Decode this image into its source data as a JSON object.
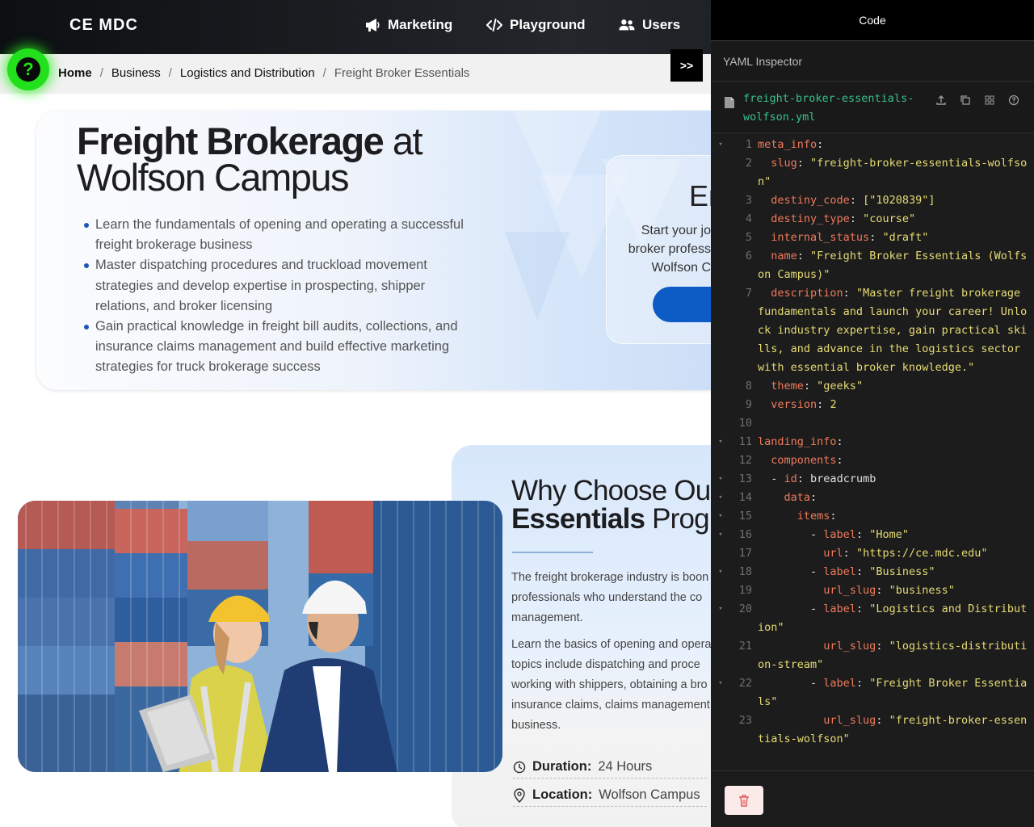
{
  "nav": {
    "brand": "CE MDC",
    "items": [
      {
        "label": "Marketing",
        "icon": "megaphone-icon"
      },
      {
        "label": "Playground",
        "icon": "code-icon"
      },
      {
        "label": "Users",
        "icon": "users-icon"
      }
    ]
  },
  "breadcrumb": {
    "items": [
      "Home",
      "Business",
      "Logistics and Distribution",
      "Freight Broker Essentials"
    ],
    "separator": "/"
  },
  "help_button": {
    "label": "?"
  },
  "toggle_button": {
    "label": ">>"
  },
  "hero": {
    "title_bold": "Freight Brokerage",
    "title_rest_1": " at",
    "title_line2": "Wolfson Campus",
    "bullets": [
      "Learn the fundamentals of opening and operating a successful freight brokerage business",
      "Master dispatching procedures and truckload movement strategies and develop expertise in prospecting, shipper relations, and broker licensing",
      "Gain practical knowledge in freight bill audits, collections, and insurance claims management and build effective marketing strategies for truck brokerage success"
    ]
  },
  "enroll": {
    "title_partial": "Er",
    "lines": [
      "Start your jo",
      "broker profess",
      "Wolfson C"
    ]
  },
  "why": {
    "title_line1": "Why Choose Ou",
    "title_bold": "Essentials",
    "title_rest": " Prog",
    "para1": [
      "The freight brokerage industry is boon",
      "professionals who understand the co",
      "management."
    ],
    "para2": [
      "Learn the basics of opening and opera",
      "topics include dispatching and proce",
      "working with shippers, obtaining a bro",
      "insurance claims, claims management",
      "business."
    ],
    "duration_label": "Duration:",
    "duration_value": "24 Hours",
    "location_label": "Location:",
    "location_value": "Wolfson Campus"
  },
  "inspector": {
    "header": "Code",
    "subheader": "YAML Inspector",
    "filename": "freight-broker-essentials-wolfson.yml",
    "actions": [
      "upload-icon",
      "copy-icon",
      "grid-icon",
      "help-icon"
    ],
    "lines": [
      {
        "n": "1",
        "fold": true,
        "segs": [
          [
            "k",
            "meta_info"
          ],
          [
            "p",
            ":"
          ]
        ]
      },
      {
        "n": "2",
        "fold": false,
        "segs": [
          [
            "p",
            "  "
          ],
          [
            "k",
            "slug"
          ],
          [
            "p",
            ": "
          ],
          [
            "s",
            "\"freight-broker-essentials-wolfson\""
          ]
        ]
      },
      {
        "n": "3",
        "fold": false,
        "segs": [
          [
            "p",
            "  "
          ],
          [
            "k",
            "destiny_code"
          ],
          [
            "p",
            ": "
          ],
          [
            "s",
            "[\"1020839\"]"
          ]
        ]
      },
      {
        "n": "4",
        "fold": false,
        "segs": [
          [
            "p",
            "  "
          ],
          [
            "k",
            "destiny_type"
          ],
          [
            "p",
            ": "
          ],
          [
            "s",
            "\"course\""
          ]
        ]
      },
      {
        "n": "5",
        "fold": false,
        "segs": [
          [
            "p",
            "  "
          ],
          [
            "k",
            "internal_status"
          ],
          [
            "p",
            ": "
          ],
          [
            "s",
            "\"draft\""
          ]
        ]
      },
      {
        "n": "6",
        "fold": false,
        "segs": [
          [
            "p",
            "  "
          ],
          [
            "k",
            "name"
          ],
          [
            "p",
            ": "
          ],
          [
            "s",
            "\"Freight Broker Essentials (Wolfson Campus)\""
          ]
        ]
      },
      {
        "n": "7",
        "fold": false,
        "segs": [
          [
            "p",
            "  "
          ],
          [
            "k",
            "description"
          ],
          [
            "p",
            ": "
          ],
          [
            "s",
            "\"Master freight brokerage fundamentals and launch your career! Unlock industry expertise, gain practical skills, and advance in the logistics sector with essential broker knowledge.\""
          ]
        ]
      },
      {
        "n": "8",
        "fold": false,
        "segs": [
          [
            "p",
            "  "
          ],
          [
            "k",
            "theme"
          ],
          [
            "p",
            ": "
          ],
          [
            "s",
            "\"geeks\""
          ]
        ]
      },
      {
        "n": "9",
        "fold": false,
        "segs": [
          [
            "p",
            "  "
          ],
          [
            "k",
            "version"
          ],
          [
            "p",
            ": "
          ],
          [
            "n",
            "2"
          ]
        ]
      },
      {
        "n": "10",
        "fold": false,
        "segs": [
          [
            "p",
            ""
          ]
        ]
      },
      {
        "n": "11",
        "fold": true,
        "segs": [
          [
            "k",
            "landing_info"
          ],
          [
            "p",
            ":"
          ]
        ]
      },
      {
        "n": "12",
        "fold": false,
        "segs": [
          [
            "p",
            "  "
          ],
          [
            "k",
            "components"
          ],
          [
            "p",
            ":"
          ]
        ]
      },
      {
        "n": "13",
        "fold": true,
        "segs": [
          [
            "p",
            "  - "
          ],
          [
            "k",
            "id"
          ],
          [
            "p",
            ": breadcrumb"
          ]
        ]
      },
      {
        "n": "14",
        "fold": true,
        "segs": [
          [
            "p",
            "    "
          ],
          [
            "k",
            "data"
          ],
          [
            "p",
            ":"
          ]
        ]
      },
      {
        "n": "15",
        "fold": true,
        "segs": [
          [
            "p",
            "      "
          ],
          [
            "k",
            "items"
          ],
          [
            "p",
            ":"
          ]
        ]
      },
      {
        "n": "16",
        "fold": true,
        "segs": [
          [
            "p",
            "        - "
          ],
          [
            "k",
            "label"
          ],
          [
            "p",
            ": "
          ],
          [
            "s",
            "\"Home\""
          ]
        ]
      },
      {
        "n": "17",
        "fold": false,
        "segs": [
          [
            "p",
            "          "
          ],
          [
            "k",
            "url"
          ],
          [
            "p",
            ": "
          ],
          [
            "s",
            "\"https://ce.mdc.edu\""
          ]
        ]
      },
      {
        "n": "18",
        "fold": true,
        "segs": [
          [
            "p",
            "        - "
          ],
          [
            "k",
            "label"
          ],
          [
            "p",
            ": "
          ],
          [
            "s",
            "\"Business\""
          ]
        ]
      },
      {
        "n": "19",
        "fold": false,
        "segs": [
          [
            "p",
            "          "
          ],
          [
            "k",
            "url_slug"
          ],
          [
            "p",
            ": "
          ],
          [
            "s",
            "\"business\""
          ]
        ]
      },
      {
        "n": "20",
        "fold": true,
        "segs": [
          [
            "p",
            "        - "
          ],
          [
            "k",
            "label"
          ],
          [
            "p",
            ": "
          ],
          [
            "s",
            "\"Logistics and Distribution\""
          ]
        ]
      },
      {
        "n": "21",
        "fold": false,
        "segs": [
          [
            "p",
            "          "
          ],
          [
            "k",
            "url_slug"
          ],
          [
            "p",
            ": "
          ],
          [
            "s",
            "\"logistics-distribution-stream\""
          ]
        ]
      },
      {
        "n": "22",
        "fold": true,
        "segs": [
          [
            "p",
            "        - "
          ],
          [
            "k",
            "label"
          ],
          [
            "p",
            ": "
          ],
          [
            "s",
            "\"Freight Broker Essentials\""
          ]
        ]
      },
      {
        "n": "23",
        "fold": false,
        "segs": [
          [
            "p",
            "          "
          ],
          [
            "k",
            "url_slug"
          ],
          [
            "p",
            ": "
          ],
          [
            "s",
            "\"freight-broker-essentials-wolfson\""
          ]
        ]
      }
    ]
  },
  "colors": {
    "nav_bg": "#1a1c20",
    "accent_green": "#22e01b",
    "brand_blue": "#0d5bc4",
    "yaml_key": "#f07a5b",
    "yaml_string": "#e6db74",
    "filename": "#38c08a"
  }
}
